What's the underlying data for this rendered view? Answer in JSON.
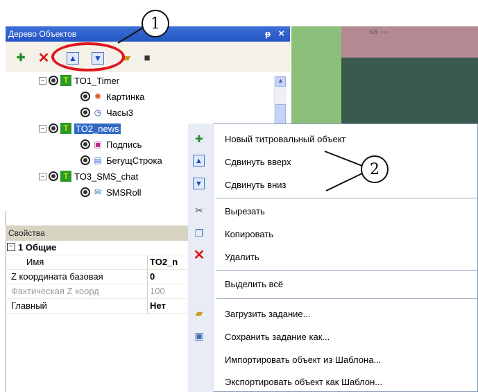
{
  "panel": {
    "title": "Дерево Объектов",
    "pin": "ᵽ",
    "close": "×"
  },
  "tree": [
    {
      "label": "TO1_Timer"
    },
    {
      "label": "Картинка"
    },
    {
      "label": "Часы3"
    },
    {
      "label": "TO2_news",
      "selected": true
    },
    {
      "label": "Подпись"
    },
    {
      "label": "БегущСтрока"
    },
    {
      "label": "TO3_SMS_chat"
    },
    {
      "label": "SMSRoll"
    }
  ],
  "properties": {
    "header": "Свойства",
    "group": "1 Общие",
    "rows": [
      {
        "key": "Имя",
        "value": "TO2_n"
      },
      {
        "key": "Z координата базовая",
        "value": "0"
      },
      {
        "key": "Фактическая Z коорд",
        "value": "100"
      },
      {
        "key": "Главный",
        "value": "Нет"
      }
    ]
  },
  "canvas": {
    "partial_text": "ка —"
  },
  "menu": {
    "items": [
      {
        "label": "Новый титровальный объект",
        "icon": "new-object-icon"
      },
      {
        "label": "Сдвинуть вверх",
        "icon": "move-up-icon"
      },
      {
        "label": "Сдвинуть вниз",
        "icon": "move-down-icon"
      },
      {
        "label": "Вырезать",
        "icon": "scissors-icon"
      },
      {
        "label": "Копировать",
        "icon": "copy-icon"
      },
      {
        "label": "Удалить",
        "icon": "delete-icon"
      },
      {
        "label": "Выделить всё",
        "icon": ""
      },
      {
        "label": "Загрузить задание...",
        "icon": "open-folder-icon"
      },
      {
        "label": "Сохранить задание как...",
        "icon": "save-as-icon"
      },
      {
        "label": "Импортировать объект из Шаблона...",
        "icon": ""
      },
      {
        "label": "Экспортировать объект как  Шаблон...",
        "icon": ""
      }
    ]
  },
  "callouts": {
    "one": "1",
    "two": "2"
  },
  "colors": {
    "titlebar": "#2455c4",
    "highlight_ring": "#e0161a",
    "selection": "#316ac5"
  }
}
